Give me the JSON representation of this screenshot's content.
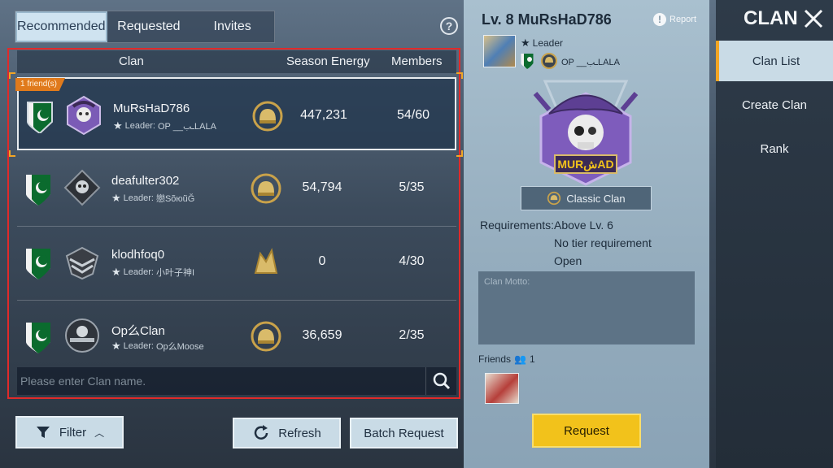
{
  "tabs": [
    {
      "label": "Recommended",
      "active": true
    },
    {
      "label": "Requested",
      "active": false
    },
    {
      "label": "Invites",
      "active": false
    }
  ],
  "help_icon": "question-icon",
  "list": {
    "columns": {
      "clan": "Clan",
      "energy": "Season Energy",
      "members": "Members"
    },
    "rows": [
      {
        "badge": "1 friend(s)",
        "name": "MuRsHaD786",
        "leader_prefix": "Leader:",
        "leader": "OP __ـبLALA",
        "energy": "447,231",
        "members": "54/60",
        "selected": true
      },
      {
        "badge": "",
        "name": "deafulter302",
        "leader_prefix": "Leader:",
        "leader": "戀SõюũĞ",
        "energy": "54,794",
        "members": "5/35",
        "selected": false
      },
      {
        "badge": "",
        "name": "klodhfoq0",
        "leader_prefix": "Leader:",
        "leader": "小叶子神I",
        "energy": "0",
        "members": "4/30",
        "selected": false
      },
      {
        "badge": "",
        "name": "Op么Clan",
        "leader_prefix": "Leader:",
        "leader": "Op么Moose",
        "energy": "36,659",
        "members": "2/35",
        "selected": false
      }
    ]
  },
  "search": {
    "placeholder": "Please enter Clan name."
  },
  "buttons": {
    "filter": "Filter",
    "refresh": "Refresh",
    "batch": "Batch Request"
  },
  "detail": {
    "title": "Lv. 8 MuRsHaD786",
    "report": "Report",
    "role": "Leader",
    "leader_name": "OP __ـبLALA",
    "emblem_text": "MURشAD",
    "clan_type": "Classic Clan",
    "requirements_label": "Requirements:",
    "requirements": [
      "Above Lv. 6",
      "No tier requirement",
      "Open"
    ],
    "motto_label": "Clan Motto:",
    "friends_label": "Friends",
    "friends_count": "1",
    "request": "Request"
  },
  "side": {
    "title": "CLAN",
    "items": [
      {
        "label": "Clan List",
        "active": true
      },
      {
        "label": "Create Clan",
        "active": false
      },
      {
        "label": "Rank",
        "active": false
      }
    ]
  },
  "colors": {
    "accent": "#f2a524",
    "request": "#f2c21b",
    "selection_frame": "#e02a2a",
    "flag_green": "#0b6b2e"
  }
}
